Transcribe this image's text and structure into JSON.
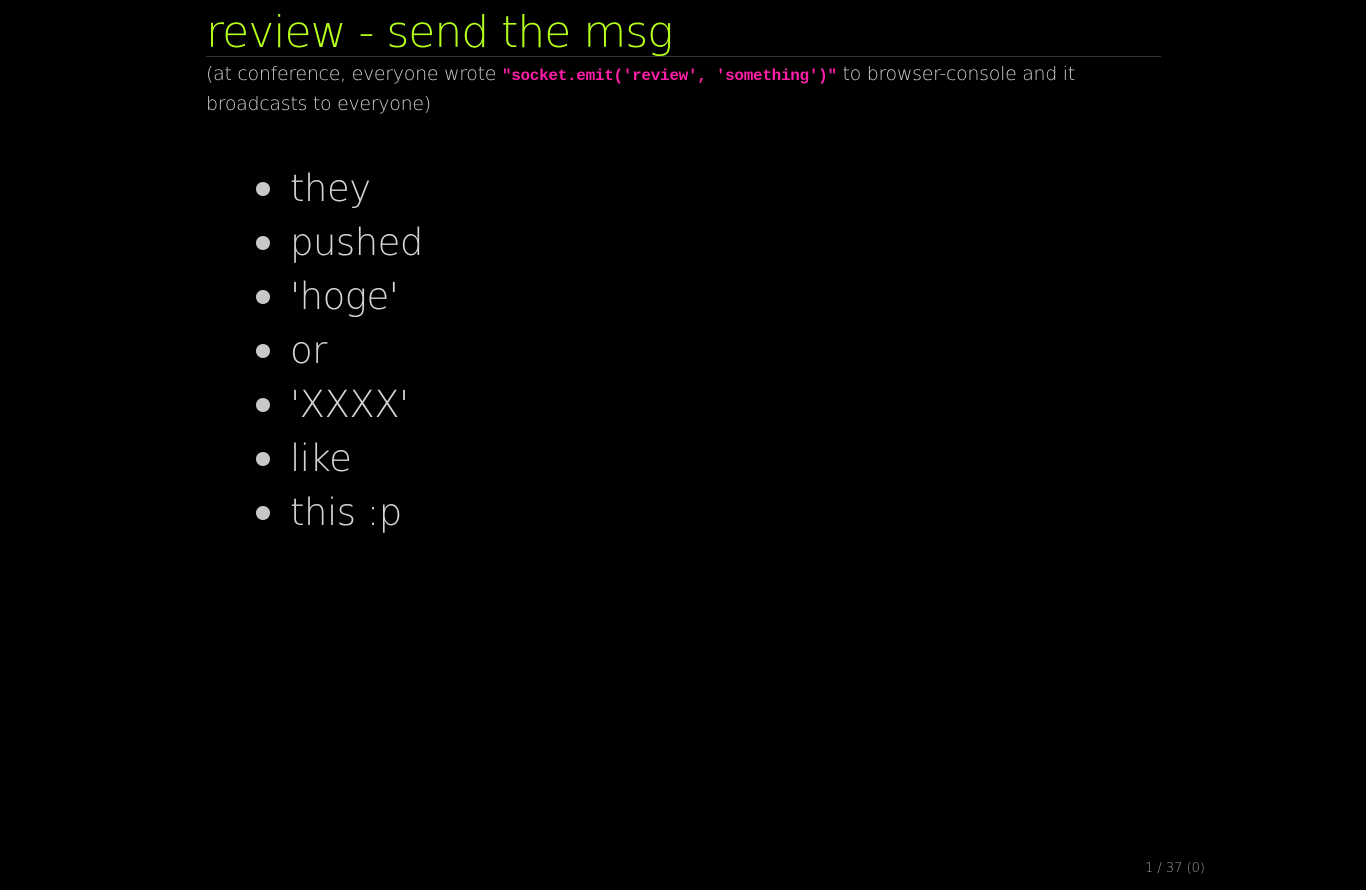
{
  "slide": {
    "title": "review - send the msg",
    "subtitle": {
      "prefix": "(at conference, everyone wrote ",
      "code": "\"socket.emit('review', 'something')\"",
      "suffix": " to browser-console and it broadcasts to everyone)"
    },
    "bullets": [
      "they",
      "pushed",
      "'hoge'",
      "or",
      "'XXXX'",
      "like",
      "this :p"
    ],
    "page_counter": "1 / 37 (0)"
  },
  "colors": {
    "background": "#000000",
    "title": "#b5ff1c",
    "code": "#ff1fa8",
    "text": "#d4d4d4"
  }
}
